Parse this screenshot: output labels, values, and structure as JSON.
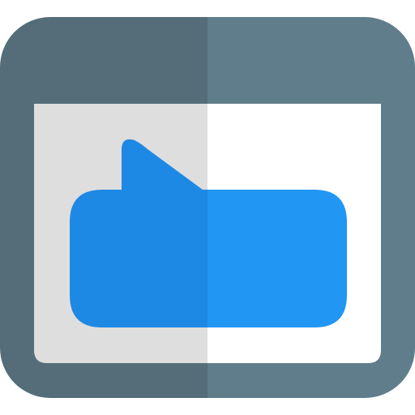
{
  "icon": {
    "name": "browser-window-chat-icon",
    "colors": {
      "frame_dark": "#546d79",
      "frame_light": "#607d8b",
      "content_dark": "#dedede",
      "content_light": "#ffffff",
      "bubble_dark": "#1e88e5",
      "bubble_light": "#2196f3"
    }
  }
}
